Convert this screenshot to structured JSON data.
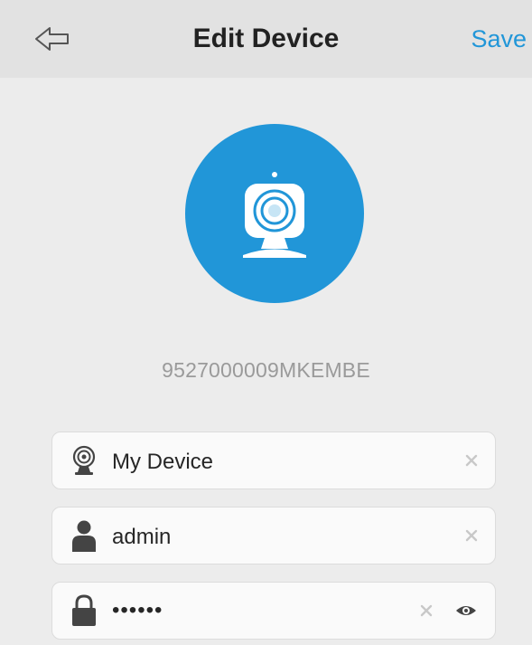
{
  "header": {
    "title": "Edit Device",
    "save_label": "Save",
    "back_icon": "back-arrow-icon"
  },
  "colors": {
    "accent": "#2196d8",
    "header_bg": "#e2e2e2",
    "page_bg": "#ececec",
    "muted_text": "#9a9a9a"
  },
  "device": {
    "id": "9527000009MKEMBE",
    "avatar_icon": "webcam-icon"
  },
  "fields": {
    "name": {
      "value": "My Device",
      "icon": "camera-icon"
    },
    "user": {
      "value": "admin",
      "icon": "user-icon"
    },
    "password": {
      "value": "••••••",
      "icon": "lock-icon",
      "toggle_icon": "eye-icon"
    }
  }
}
